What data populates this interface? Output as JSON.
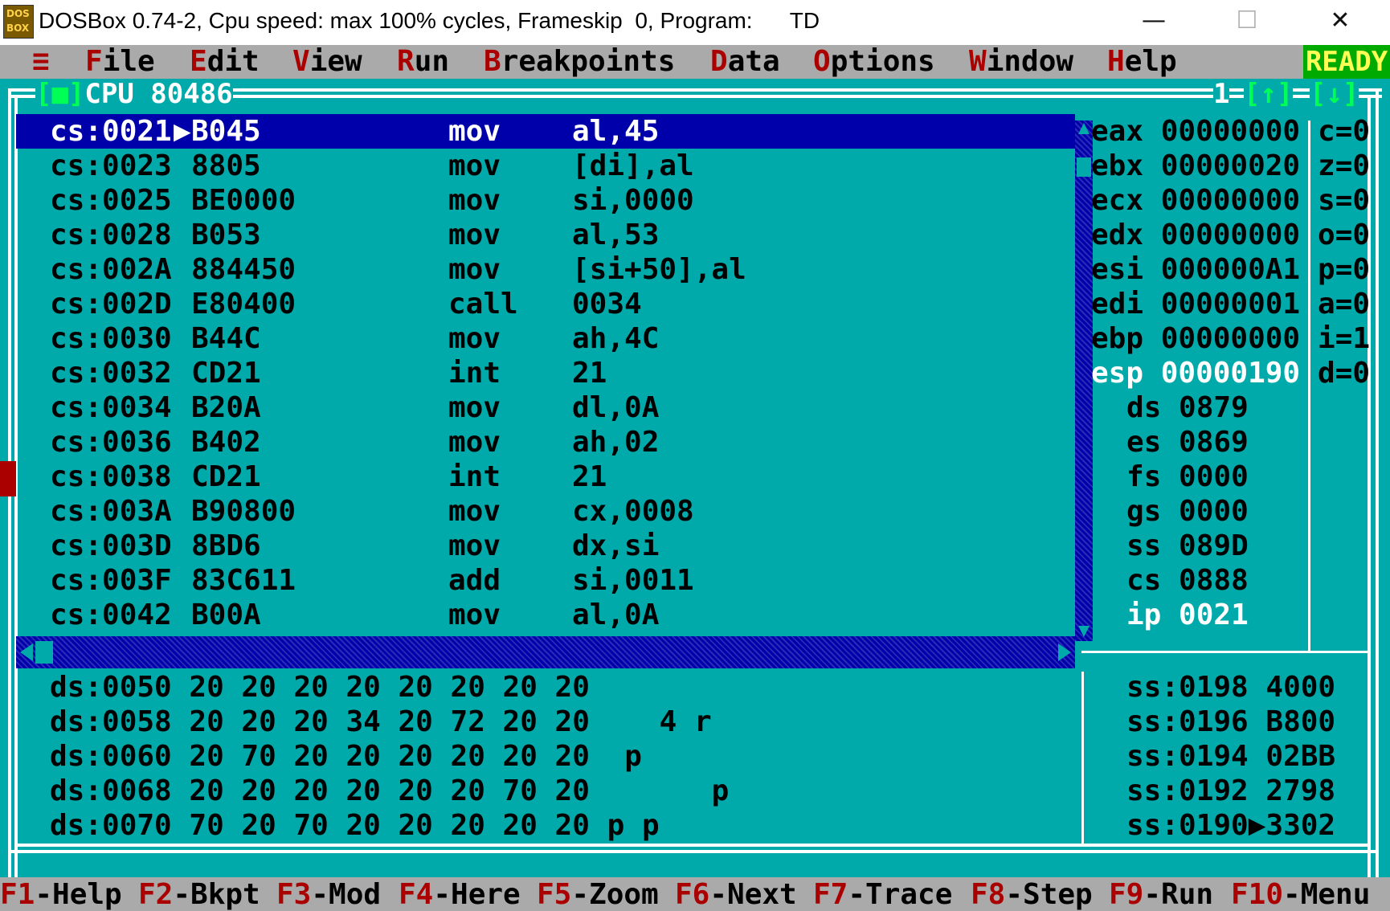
{
  "window": {
    "title": "DOSBox 0.74-2, Cpu speed: max 100% cycles, Frameskip  0, Program:      TD",
    "icon_name": "dosbox-icon",
    "icon_line1": "DOS",
    "icon_line2": "BOX",
    "minimize": "—",
    "maximize": "☐",
    "close": "✕"
  },
  "menu": {
    "system": "≡",
    "items": [
      {
        "hk": "F",
        "rest": "ile"
      },
      {
        "hk": "E",
        "rest": "dit"
      },
      {
        "hk": "V",
        "rest": "iew"
      },
      {
        "hk": "R",
        "rest": "un"
      },
      {
        "hk": "B",
        "rest": "reakpoints"
      },
      {
        "hk": "D",
        "rest": "ata"
      },
      {
        "hk": "O",
        "rest": "ptions"
      },
      {
        "hk": "W",
        "rest": "indow"
      },
      {
        "hk": "H",
        "rest": "elp"
      }
    ],
    "status": "READY"
  },
  "cpu_window": {
    "close_box": "[■]",
    "title": "CPU 80486",
    "window_number": "1",
    "zoom_up": "[↑]",
    "zoom_down": "[↓]",
    "code": [
      {
        "addr": "cs:0021",
        "bytes": "B045",
        "mnemonic": "mov",
        "operands": "al,45",
        "current": true
      },
      {
        "addr": "cs:0023",
        "bytes": "8805",
        "mnemonic": "mov",
        "operands": "[di],al"
      },
      {
        "addr": "cs:0025",
        "bytes": "BE0000",
        "mnemonic": "mov",
        "operands": "si,0000"
      },
      {
        "addr": "cs:0028",
        "bytes": "B053",
        "mnemonic": "mov",
        "operands": "al,53"
      },
      {
        "addr": "cs:002A",
        "bytes": "884450",
        "mnemonic": "mov",
        "operands": "[si+50],al"
      },
      {
        "addr": "cs:002D",
        "bytes": "E80400",
        "mnemonic": "call",
        "operands": "0034"
      },
      {
        "addr": "cs:0030",
        "bytes": "B44C",
        "mnemonic": "mov",
        "operands": "ah,4C"
      },
      {
        "addr": "cs:0032",
        "bytes": "CD21",
        "mnemonic": "int",
        "operands": "21"
      },
      {
        "addr": "cs:0034",
        "bytes": "B20A",
        "mnemonic": "mov",
        "operands": "dl,0A"
      },
      {
        "addr": "cs:0036",
        "bytes": "B402",
        "mnemonic": "mov",
        "operands": "ah,02"
      },
      {
        "addr": "cs:0038",
        "bytes": "CD21",
        "mnemonic": "int",
        "operands": "21"
      },
      {
        "addr": "cs:003A",
        "bytes": "B90800",
        "mnemonic": "mov",
        "operands": "cx,0008"
      },
      {
        "addr": "cs:003D",
        "bytes": "8BD6",
        "mnemonic": "mov",
        "operands": "dx,si"
      },
      {
        "addr": "cs:003F",
        "bytes": "83C611",
        "mnemonic": "add",
        "operands": "si,0011"
      },
      {
        "addr": "cs:0042",
        "bytes": "B00A",
        "mnemonic": "mov",
        "operands": "al,0A"
      }
    ],
    "current_marker": "▶",
    "registers": [
      {
        "name": "eax",
        "value": "00000000"
      },
      {
        "name": "ebx",
        "value": "00000020"
      },
      {
        "name": "ecx",
        "value": "00000000"
      },
      {
        "name": "edx",
        "value": "00000000"
      },
      {
        "name": "esi",
        "value": "000000A1"
      },
      {
        "name": "edi",
        "value": "00000001"
      },
      {
        "name": "ebp",
        "value": "00000000"
      },
      {
        "name": "esp",
        "value": "00000190",
        "changed": true
      }
    ],
    "segments": [
      {
        "name": "ds",
        "value": "0879"
      },
      {
        "name": "es",
        "value": "0869"
      },
      {
        "name": "fs",
        "value": "0000"
      },
      {
        "name": "gs",
        "value": "0000"
      },
      {
        "name": "ss",
        "value": "089D"
      },
      {
        "name": "cs",
        "value": "0888"
      },
      {
        "name": "ip",
        "value": "0021"
      }
    ],
    "flags": [
      "c=0",
      "z=0",
      "s=0",
      "o=0",
      "p=0",
      "a=0",
      "i=1",
      "d=0"
    ],
    "dump": [
      {
        "addr": "ds:0050",
        "bytes": "20 20 20 20 20 20 20 20",
        "ascii": ""
      },
      {
        "addr": "ds:0058",
        "bytes": "20 20 20 34 20 72 20 20",
        "ascii": "   4 r  "
      },
      {
        "addr": "ds:0060",
        "bytes": "20 70 20 20 20 20 20 20",
        "ascii": " p      "
      },
      {
        "addr": "ds:0068",
        "bytes": "20 20 20 20 20 20 70 20",
        "ascii": "      p "
      },
      {
        "addr": "ds:0070",
        "bytes": "70 20 70 20 20 20 20 20",
        "ascii": "p p     "
      }
    ],
    "stack": [
      {
        "addr": "ss:0198",
        "value": "4000",
        "sep": " "
      },
      {
        "addr": "ss:0196",
        "value": "B800",
        "sep": " "
      },
      {
        "addr": "ss:0194",
        "value": "02BB",
        "sep": " "
      },
      {
        "addr": "ss:0192",
        "value": "2798",
        "sep": " "
      },
      {
        "addr": "ss:0190",
        "value": "3302",
        "sep": "▶"
      }
    ]
  },
  "keybar": [
    {
      "key": "F1",
      "label": "-Help"
    },
    {
      "key": "F2",
      "label": "-Bkpt"
    },
    {
      "key": "F3",
      "label": "-Mod"
    },
    {
      "key": "F4",
      "label": "-Here"
    },
    {
      "key": "F5",
      "label": "-Zoom"
    },
    {
      "key": "F6",
      "label": "-Next"
    },
    {
      "key": "F7",
      "label": "-Trace"
    },
    {
      "key": "F8",
      "label": "-Step"
    },
    {
      "key": "F9",
      "label": "-Run"
    },
    {
      "key": "F10",
      "label": "-Menu"
    }
  ]
}
